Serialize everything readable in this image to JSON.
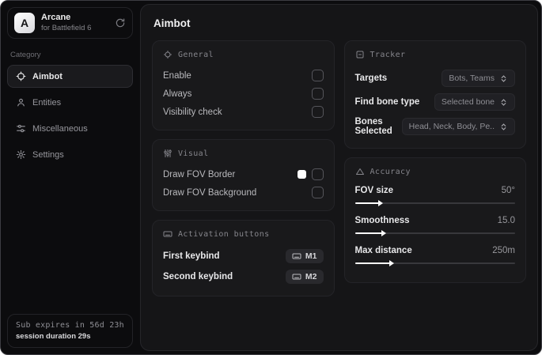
{
  "sidebar": {
    "logo": {
      "letter": "A",
      "title": "Arcane",
      "subtitle": "for Battlefield 6"
    },
    "category_label": "Category",
    "items": [
      {
        "label": "Aimbot",
        "active": true
      },
      {
        "label": "Entities",
        "active": false
      },
      {
        "label": "Miscellaneous",
        "active": false
      },
      {
        "label": "Settings",
        "active": false
      }
    ],
    "subscription": {
      "expires": "Sub expires in 56d 23h",
      "session": "session duration 29s"
    }
  },
  "main": {
    "title": "Aimbot",
    "general": {
      "header": "General",
      "rows": [
        {
          "label": "Enable",
          "checked": false
        },
        {
          "label": "Always",
          "checked": false
        },
        {
          "label": "Visibility check",
          "checked": false
        }
      ]
    },
    "visual": {
      "header": "Visual",
      "rows": [
        {
          "label": "Draw FOV Border",
          "swatch_color": "#ffffff",
          "checked": false
        },
        {
          "label": "Draw FOV Background",
          "checked": false
        }
      ]
    },
    "activation": {
      "header": "Activation buttons",
      "rows": [
        {
          "label": "First keybind",
          "key": "M1"
        },
        {
          "label": "Second keybind",
          "key": "M2"
        }
      ]
    },
    "tracker": {
      "header": "Tracker",
      "rows": [
        {
          "label": "Targets",
          "value": "Bots, Teams"
        },
        {
          "label": "Find bone type",
          "value": "Selected bone"
        },
        {
          "label": "Bones Selected",
          "value": "Head, Neck, Body, Pe.."
        }
      ]
    },
    "accuracy": {
      "header": "Accuracy",
      "sliders": [
        {
          "label": "FOV size",
          "value": "50°",
          "fill": "15%"
        },
        {
          "label": "Smoothness",
          "value": "15.0",
          "fill": "17%"
        },
        {
          "label": "Max distance",
          "value": "250m",
          "fill": "22%"
        }
      ]
    }
  }
}
